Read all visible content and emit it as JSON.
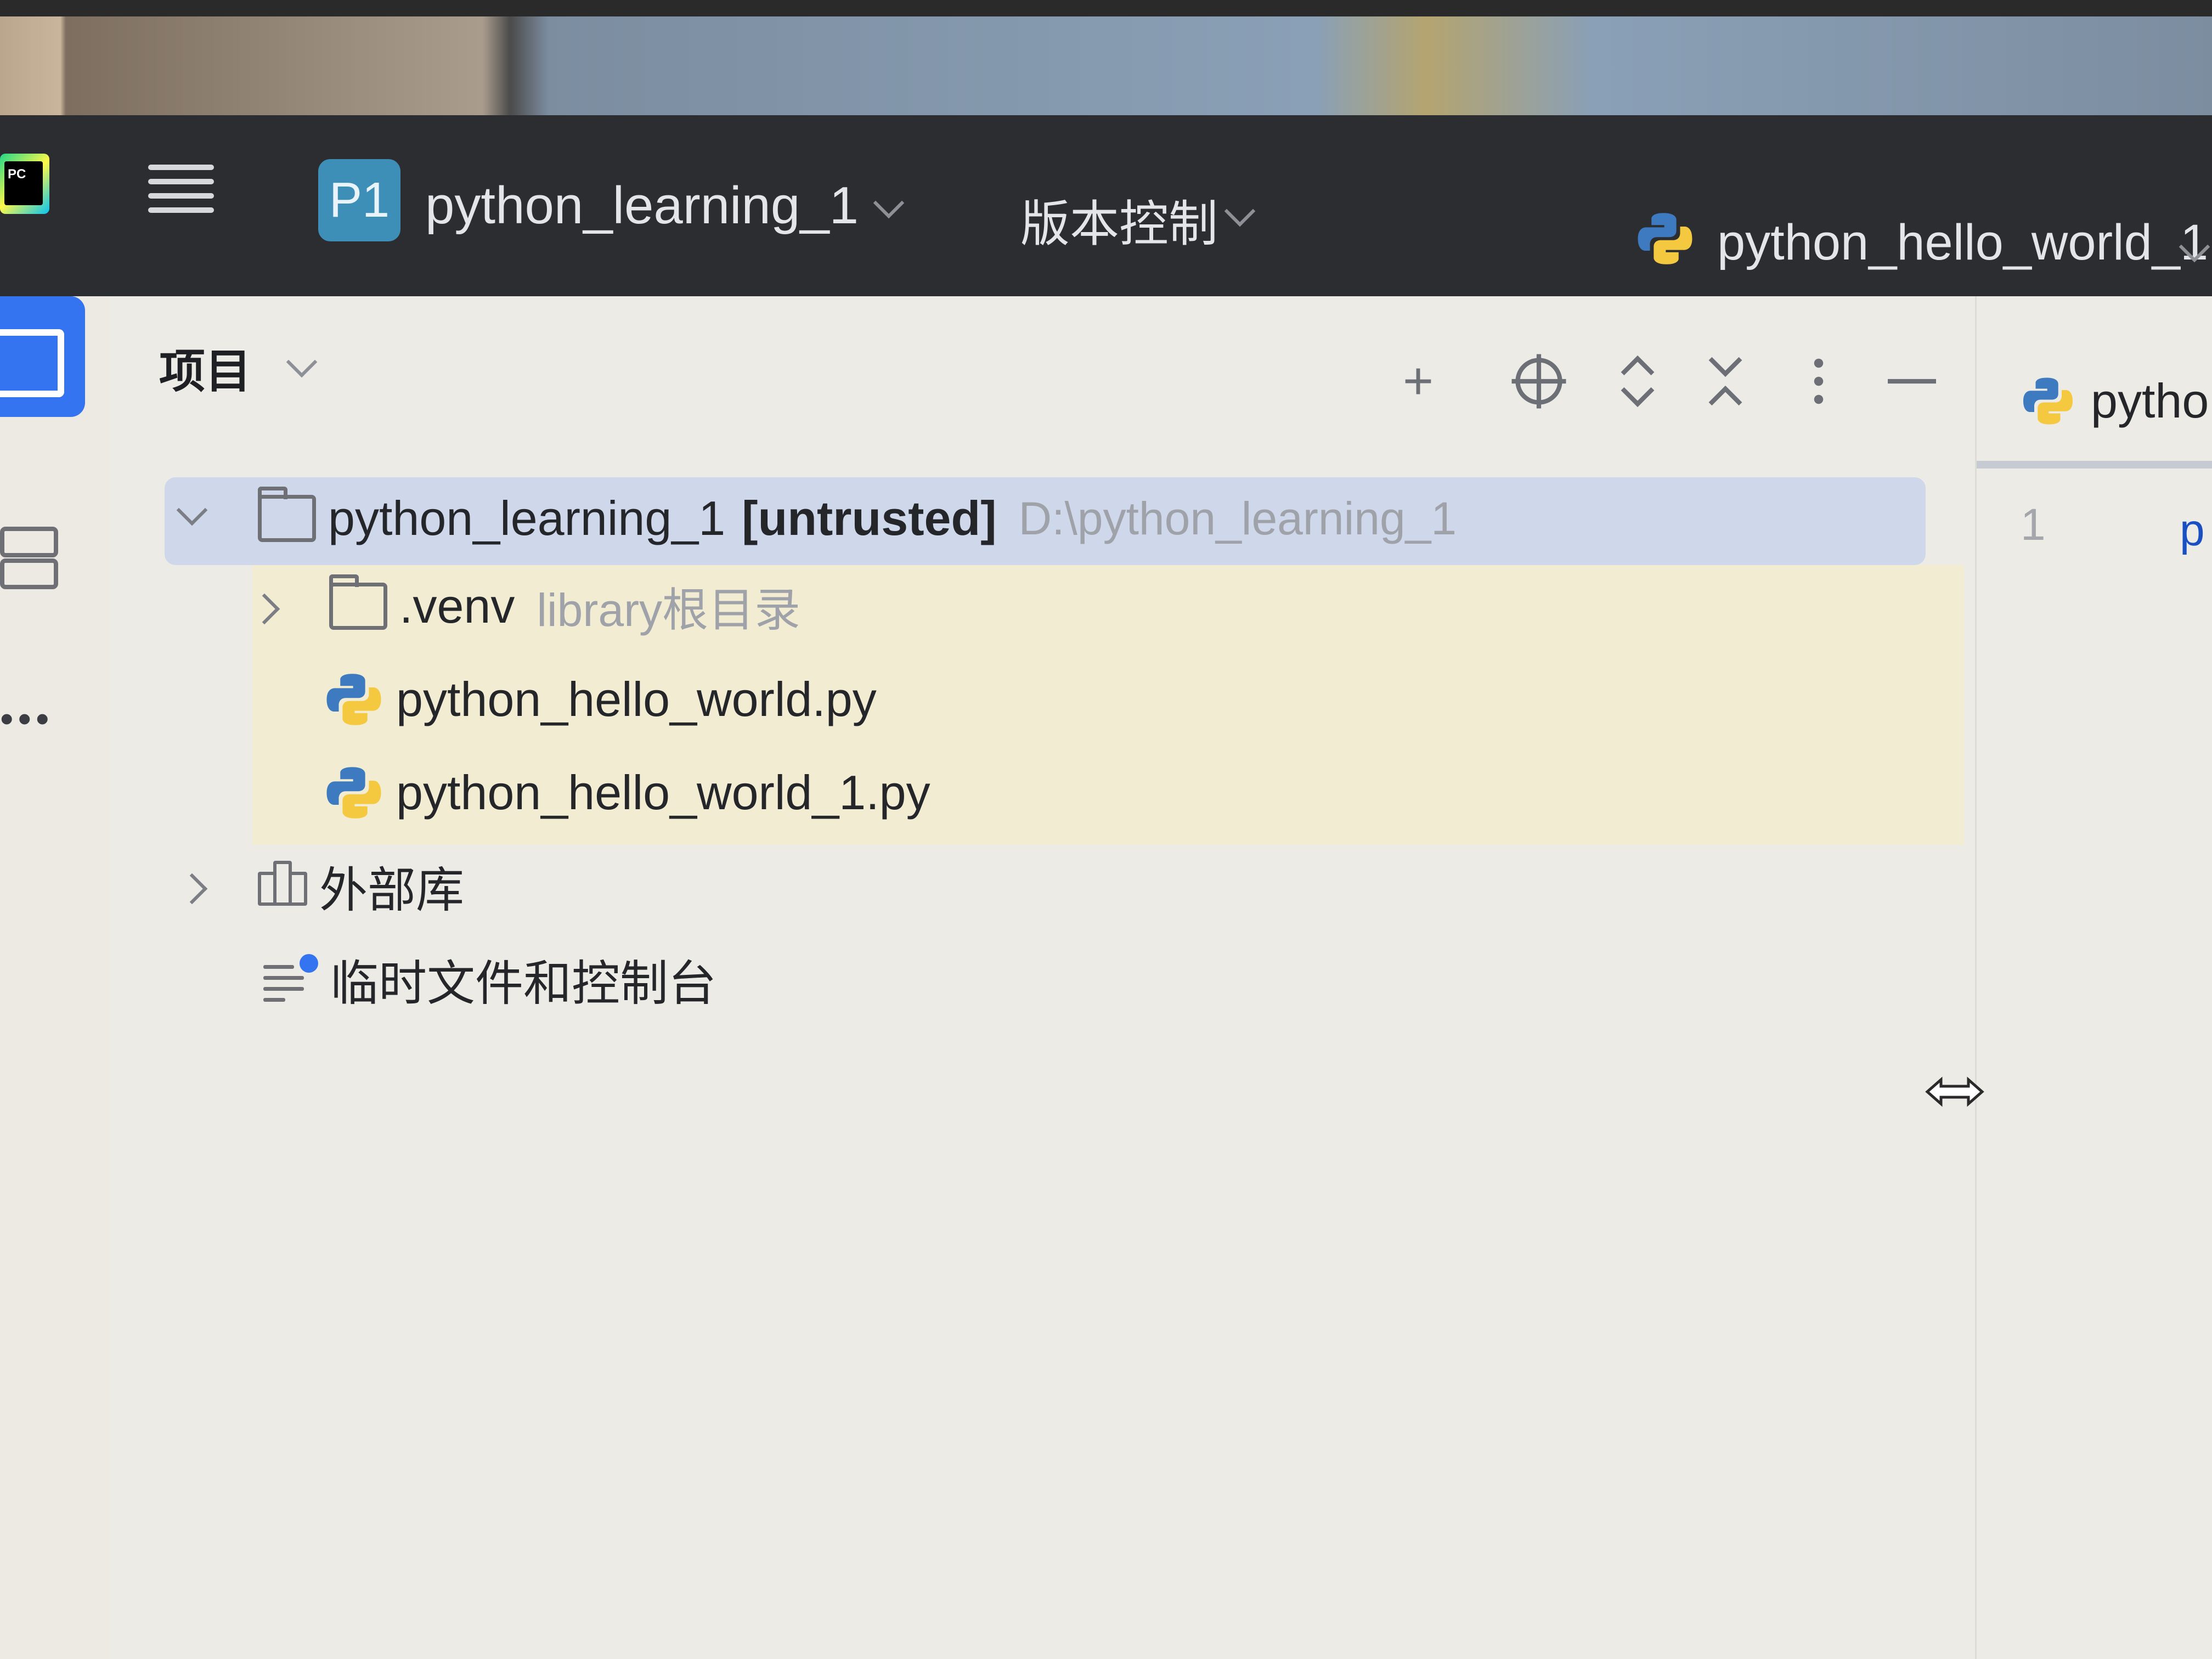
{
  "titlebar": {
    "app_logo_text": "PC",
    "project_badge": "P1",
    "project_name": "python_learning_1",
    "vcs_label": "版本控制",
    "run_config": "python_hello_world_1"
  },
  "tool_window": {
    "title": "项目"
  },
  "tree": {
    "root": {
      "name": "python_learning_1",
      "flag": "[untrusted]",
      "path": "D:\\python_learning_1"
    },
    "venv": {
      "name": ".venv",
      "hint": "library根目录"
    },
    "files": [
      "python_hello_world.py",
      "python_hello_world_1.py"
    ],
    "external_libs": "外部库",
    "scratches": "临时文件和控制台"
  },
  "editor": {
    "tab_label": "pytho",
    "line_number": "1",
    "code_start": "p"
  },
  "colors": {
    "accent": "#3574f0",
    "titlebar_bg": "#2b2d30",
    "selection_bg": "#ced8ea",
    "highlight_bg": "#f1ecd2",
    "panel_bg": "#ecebe6"
  }
}
